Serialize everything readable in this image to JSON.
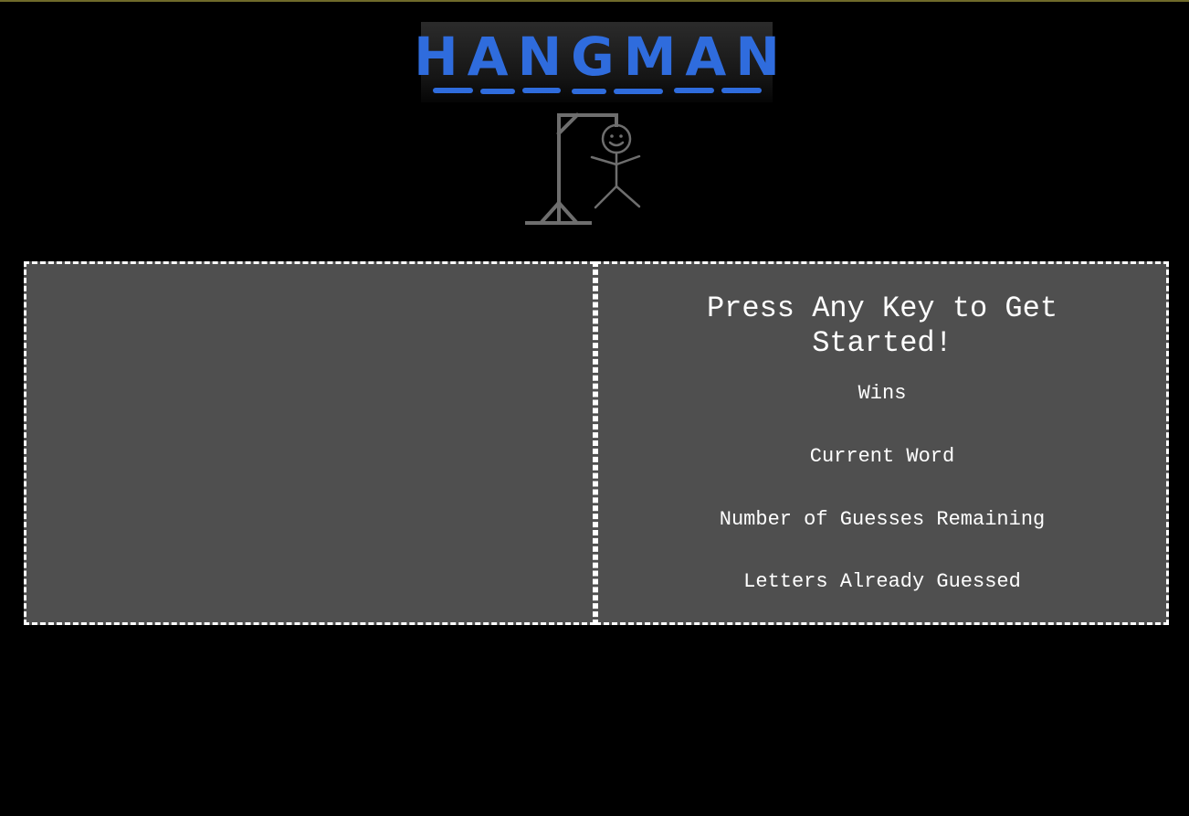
{
  "logo": {
    "text": "HANGMAN",
    "color": "#2f6cdd"
  },
  "game": {
    "prompt": "Press Any Key to Get Started!",
    "wins_label": "Wins",
    "current_word_label": "Current Word",
    "guesses_remaining_label": "Number of Guesses Remaining",
    "letters_guessed_label": "Letters Already Guessed"
  },
  "colors": {
    "background": "#000000",
    "panel": "#4f4f4f",
    "panel_border": "#ffffff",
    "text": "#ffffff",
    "gallows": "#6e6e6e"
  }
}
